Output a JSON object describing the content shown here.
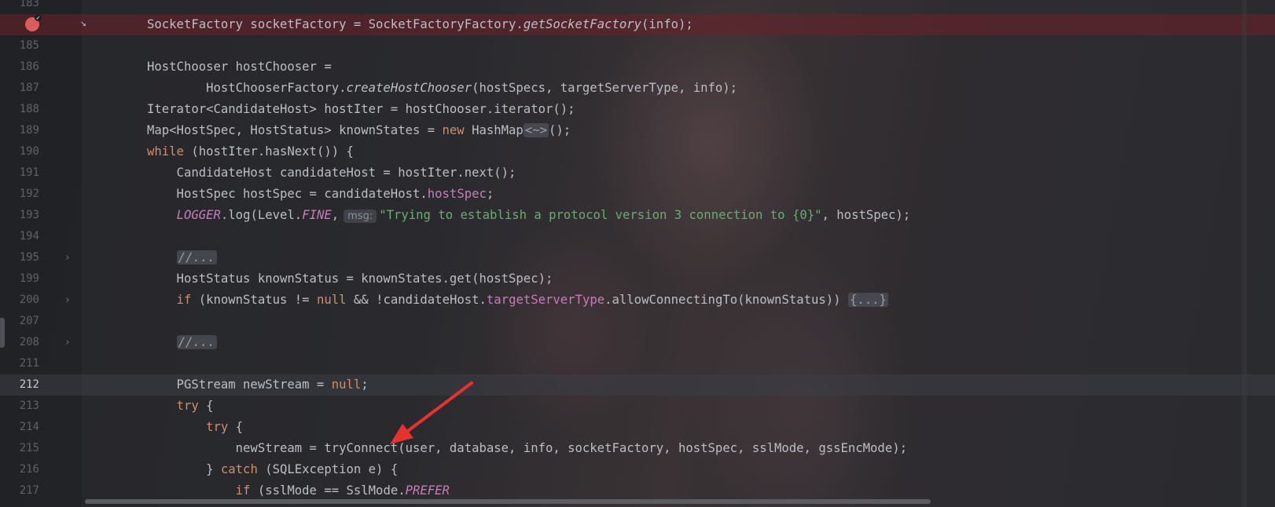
{
  "editor": {
    "lines": [
      {
        "num": "183",
        "html": ""
      },
      {
        "num": "",
        "html": "SocketFactory socketFactory = SocketFactoryFactory.<span class='it'>getSocketFactory</span>(info);"
      },
      {
        "num": "185",
        "html": ""
      },
      {
        "num": "186",
        "html": "HostChooser hostChooser ="
      },
      {
        "num": "187",
        "html": "        HostChooserFactory.<span class='it'>createHostChooser</span>(hostSpecs, targetServerType, info);"
      },
      {
        "num": "188",
        "html": "Iterator&lt;CandidateHost&gt; hostIter = hostChooser.iterator();"
      },
      {
        "num": "189",
        "html": "Map&lt;HostSpec, HostStatus&gt; knownStates = <span class='kw'>new</span> HashMap<span class='fbox'>&lt;~&gt;</span>();"
      },
      {
        "num": "190",
        "html": "<span class='kw'>while</span> (hostIter.hasNext()) {"
      },
      {
        "num": "191",
        "html": "    CandidateHost candidateHost = hostIter.next();"
      },
      {
        "num": "192",
        "html": "    HostSpec hostSpec = candidateHost.<span class='fld'>hostSpec</span>;"
      },
      {
        "num": "193",
        "html": "    <span class='cst'>LOGGER</span>.log(Level.<span class='cst'>FINE</span>,<span class='hint'>msg:</span><span class='str'>\"Trying to establish a protocol version 3 connection to {0}\"</span>, hostSpec);"
      },
      {
        "num": "194",
        "html": ""
      },
      {
        "num": "195",
        "html": "    <span class='cmt fbox'>//...</span>",
        "fold": true
      },
      {
        "num": "199",
        "html": "    HostStatus knownStatus = knownStates.get(hostSpec);"
      },
      {
        "num": "200",
        "html": "    <span class='kw'>if</span> (knownStatus != <span class='kw'>null</span> &amp;&amp; !candidateHost.<span class='fld'>targetServerType</span>.allowConnectingTo(knownStatus)) <span class='fbox'>{...}</span>",
        "fold": true
      },
      {
        "num": "207",
        "html": ""
      },
      {
        "num": "208",
        "html": "    <span class='cmt fbox'>//...</span>",
        "fold": true
      },
      {
        "num": "211",
        "html": ""
      },
      {
        "num": "212",
        "html": "    PGStream newStream = <span class='kw'>null</span>;",
        "current": true
      },
      {
        "num": "213",
        "html": "    <span class='kw'>try</span> {"
      },
      {
        "num": "214",
        "html": "        <span class='kw'>try</span> {"
      },
      {
        "num": "215",
        "html": "            newStream = tryConnect(user, database, info, socketFactory, hostSpec, sslMode, gssEncMode);"
      },
      {
        "num": "216",
        "html": "        } <span class='kw'>catch</span> (SQLException e) {"
      },
      {
        "num": "217",
        "html": "            <span class='kw'>if</span> (sslMode == SslMode.<span class='cst'>PREFER</span>"
      }
    ],
    "colors": {
      "breakpoint_line": "#6e2028",
      "keyword": "#cf8e6d",
      "string": "#6aab73",
      "field": "#c77dbb",
      "arrow": "#e8322e"
    },
    "icons": [
      "breakpoint-icon",
      "execution-pointer-icon",
      "fold-chevron-icon"
    ]
  }
}
